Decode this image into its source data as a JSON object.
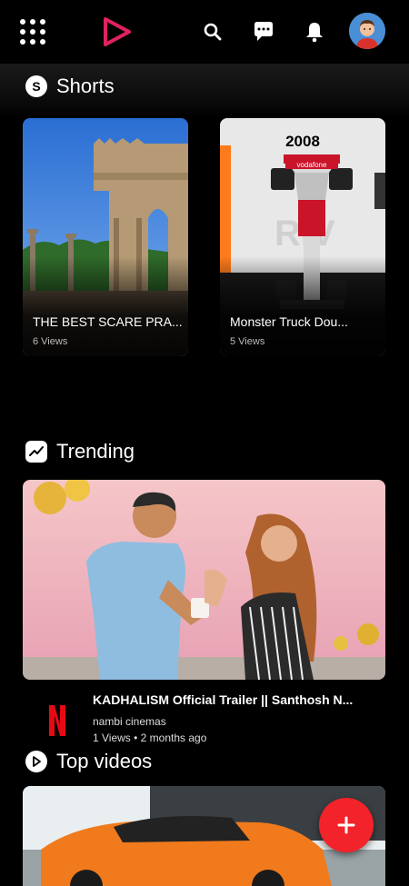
{
  "header": {
    "menu_icon": "apps-grid-icon",
    "logo_icon": "play-logo-icon",
    "search_icon": "search-icon",
    "messages_icon": "chat-bubble-icon",
    "notifications_icon": "bell-icon",
    "avatar_icon": "user-avatar",
    "logo_color": "#e0225e"
  },
  "shorts": {
    "section_title": "Shorts",
    "section_icon_letter": "S",
    "items": [
      {
        "title": "THE BEST SCARE PRA...",
        "views": "6 Views"
      },
      {
        "title": "Monster Truck Dou...",
        "views": "5 Views",
        "overlay_text": "2008",
        "badge_text": "vodafone"
      }
    ]
  },
  "trending": {
    "section_title": "Trending",
    "section_icon": "trending-chart-icon",
    "video": {
      "title": "KADHALISM Official Trailer || Santhosh N...",
      "channel": "nambi cinemas",
      "meta": "1 Views • 2 months ago",
      "channel_logo_letter": "N",
      "channel_logo_color": "#e50914"
    }
  },
  "top_videos": {
    "section_title": "Top videos",
    "section_icon": "play-circle-icon"
  },
  "fab": {
    "icon": "plus-icon",
    "label": "+",
    "color": "#f2232a"
  }
}
